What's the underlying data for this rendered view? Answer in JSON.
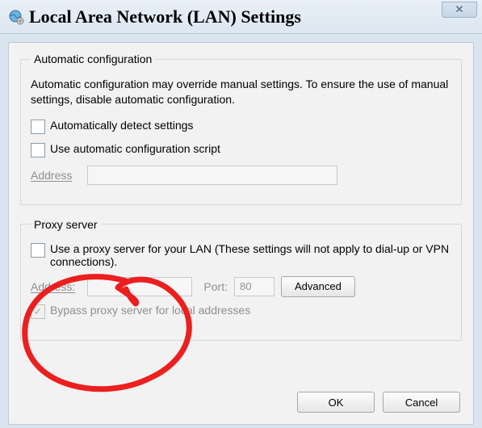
{
  "titlebar": {
    "title": "Local Area Network (LAN) Settings",
    "close_glyph": "✕"
  },
  "auto": {
    "legend": "Automatic configuration",
    "help": "Automatic configuration may override manual settings.  To ensure the use of manual settings, disable automatic configuration.",
    "auto_detect_label": "Automatically detect settings",
    "auto_script_label": "Use automatic configuration script",
    "address_label": "Address",
    "address_value": ""
  },
  "proxy": {
    "legend": "Proxy server",
    "use_proxy_label": "Use a proxy server for your LAN (These settings will not apply to dial-up or VPN connections).",
    "address_label": "Address:",
    "address_value": "",
    "port_label": "Port:",
    "port_value": "80",
    "advanced_label": "Advanced",
    "bypass_label": "Bypass proxy server for local addresses"
  },
  "footer": {
    "ok_label": "OK",
    "cancel_label": "Cancel"
  },
  "annotation": {
    "color": "#ec1f1f"
  }
}
